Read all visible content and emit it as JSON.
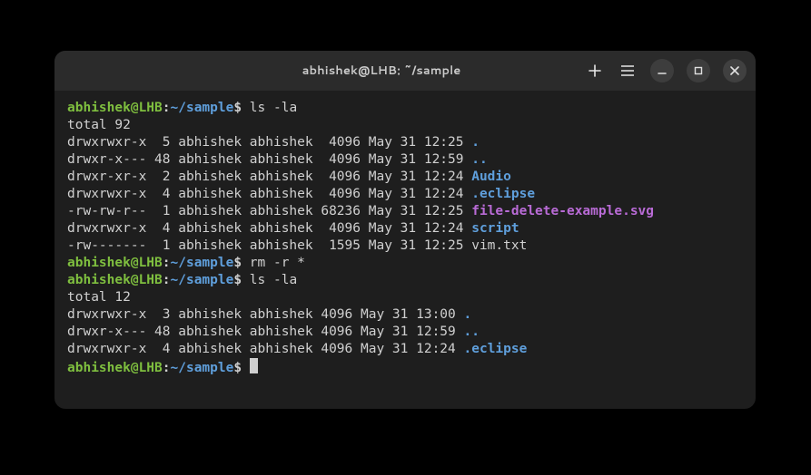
{
  "titlebar": {
    "title": "abhishek@LHB: ~/sample"
  },
  "prompt": {
    "user_host": "abhishek@LHB",
    "colon": ":",
    "path": "~/sample",
    "sigil": "$"
  },
  "commands": {
    "cmd1": " ls -la",
    "cmd2": " rm -r *",
    "cmd3": " ls -la",
    "cmd4": " "
  },
  "output1": {
    "total": "total 92",
    "rows": [
      {
        "meta": "drwxrwxr-x  5 abhishek abhishek  4096 May 31 12:25 ",
        "name": ".",
        "kind": "dir"
      },
      {
        "meta": "drwxr-x--- 48 abhishek abhishek  4096 May 31 12:59 ",
        "name": "..",
        "kind": "dir"
      },
      {
        "meta": "drwxr-xr-x  2 abhishek abhishek  4096 May 31 12:24 ",
        "name": "Audio",
        "kind": "dir"
      },
      {
        "meta": "drwxrwxr-x  4 abhishek abhishek  4096 May 31 12:24 ",
        "name": ".eclipse",
        "kind": "dir"
      },
      {
        "meta": "-rw-rw-r--  1 abhishek abhishek 68236 May 31 12:25 ",
        "name": "file-delete-example.svg",
        "kind": "file"
      },
      {
        "meta": "drwxrwxr-x  4 abhishek abhishek  4096 May 31 12:24 ",
        "name": "script",
        "kind": "dir"
      },
      {
        "meta": "-rw-------  1 abhishek abhishek  1595 May 31 12:25 ",
        "name": "vim.txt",
        "kind": "plain"
      }
    ]
  },
  "output2": {
    "total": "total 12",
    "rows": [
      {
        "meta": "drwxrwxr-x  3 abhishek abhishek 4096 May 31 13:00 ",
        "name": ".",
        "kind": "dir"
      },
      {
        "meta": "drwxr-x--- 48 abhishek abhishek 4096 May 31 12:59 ",
        "name": "..",
        "kind": "dir"
      },
      {
        "meta": "drwxrwxr-x  4 abhishek abhishek 4096 May 31 12:24 ",
        "name": ".eclipse",
        "kind": "dir"
      }
    ]
  }
}
